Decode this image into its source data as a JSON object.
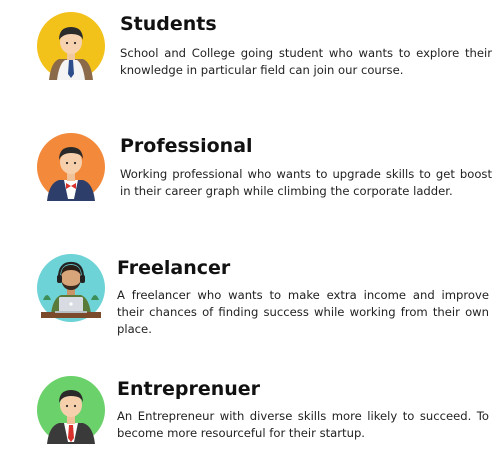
{
  "items": [
    {
      "title": "Students",
      "description": "School and College going student who wants to explore their knowledge in particular field can join our course.",
      "avatar_icon": "student-icon",
      "avatar_bg": "#F2C21B"
    },
    {
      "title": "Professional",
      "description": "Working professional who wants to upgrade skills to get boost in their career graph while climbing the corporate ladder.",
      "avatar_icon": "professional-icon",
      "avatar_bg": "#F3893A"
    },
    {
      "title": "Freelancer",
      "description": "A freelancer who wants to make extra income and improve their chances of finding success while working from their own place.",
      "avatar_icon": "freelancer-icon",
      "avatar_bg": "#6DD3D6"
    },
    {
      "title": "Entreprenuer",
      "description": "An Entrepreneur with diverse skills more likely to succeed. To become more resourceful for their startup.",
      "avatar_icon": "entrepreneur-icon",
      "avatar_bg": "#6BD16A"
    }
  ]
}
